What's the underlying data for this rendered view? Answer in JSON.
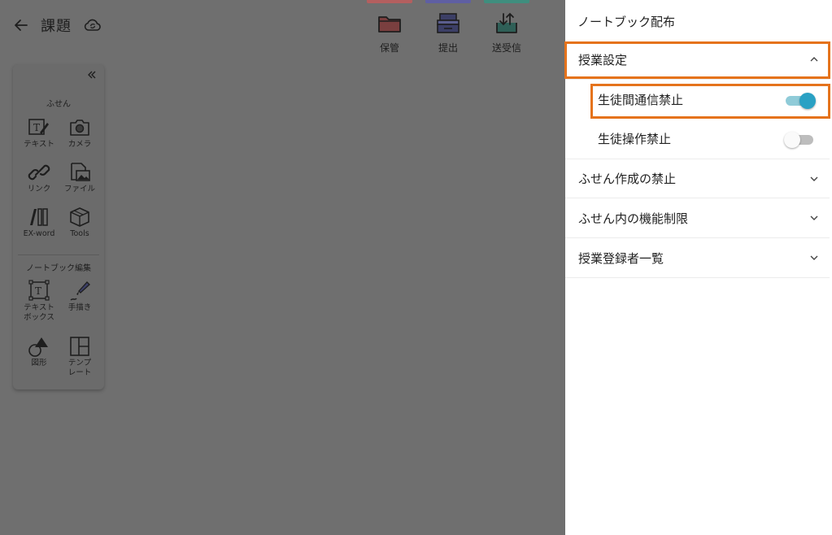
{
  "header": {
    "title": "課題",
    "back_icon": "arrow-left-icon",
    "sync_icon": "cloud-sync-icon"
  },
  "actions": [
    {
      "label": "保管",
      "icon": "folder-icon",
      "color": "#b35f5f"
    },
    {
      "label": "提出",
      "icon": "inbox-tray-icon",
      "color": "#5f5fa3"
    },
    {
      "label": "送受信",
      "icon": "send-receive-icon",
      "color": "#3f8e7e"
    }
  ],
  "toolbox": {
    "sticky_section": "ふせん",
    "sticky_tools": [
      {
        "label": "テキスト",
        "icon": "text-note-icon"
      },
      {
        "label": "カメラ",
        "icon": "camera-icon"
      },
      {
        "label": "リンク",
        "icon": "link-icon"
      },
      {
        "label": "ファイル",
        "icon": "file-image-icon"
      },
      {
        "label": "EX-word",
        "icon": "books-icon"
      },
      {
        "label": "Tools",
        "icon": "toolbox-icon"
      }
    ],
    "notebook_section": "ノートブック編集",
    "notebook_tools": [
      {
        "label": "テキスト\nボックス",
        "icon": "text-box-icon"
      },
      {
        "label": "手描き",
        "icon": "pen-icon"
      },
      {
        "label": "図形",
        "icon": "shapes-icon"
      },
      {
        "label": "テンプ\nレート",
        "icon": "template-icon"
      }
    ]
  },
  "panel": {
    "title": "ノートブック配布",
    "class_settings": {
      "label": "授業設定",
      "expanded": true,
      "options": [
        {
          "label": "生徒間通信禁止",
          "enabled": true
        },
        {
          "label": "生徒操作禁止",
          "enabled": false
        }
      ]
    },
    "sections": [
      {
        "label": "ふせん作成の禁止"
      },
      {
        "label": "ふせん内の機能制限"
      },
      {
        "label": "授業登録者一覧"
      }
    ]
  },
  "colors": {
    "accent": "#2aa1c4",
    "highlight": "#e5731c"
  }
}
